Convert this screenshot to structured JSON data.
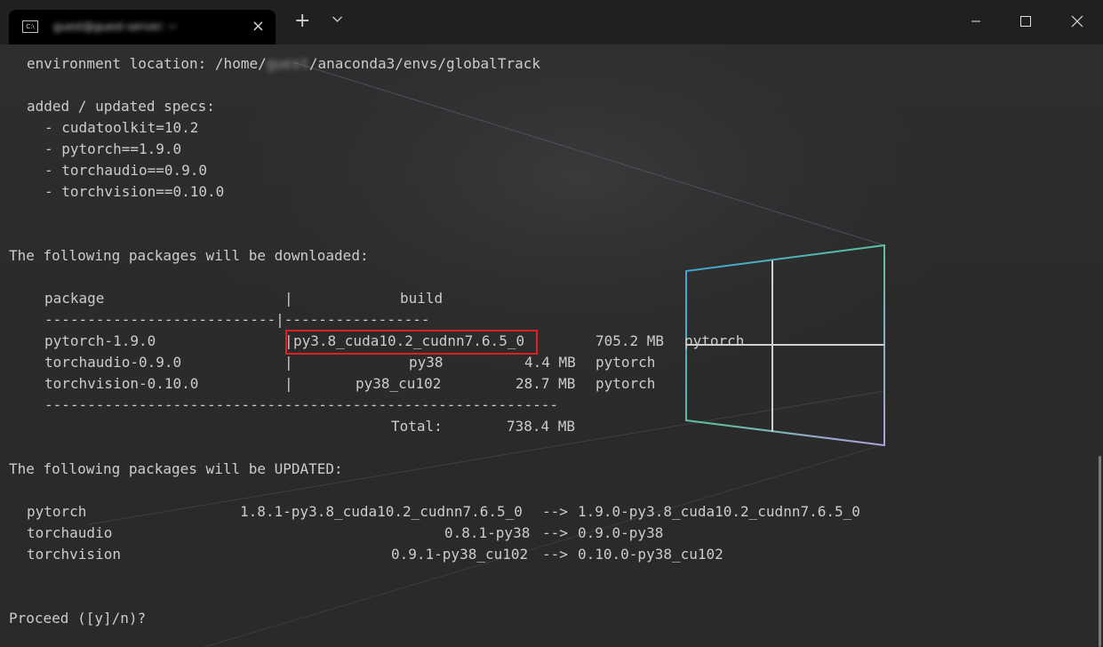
{
  "window": {
    "tab_icon_text": "C:\\",
    "tab_title": "guest@guest-server: ~",
    "tab_close_icon": "×",
    "new_tab_icon": "+"
  },
  "terminal": {
    "env_location_prefix": "environment location: /home/",
    "env_user": "guest",
    "env_location_suffix": "/anaconda3/envs/globalTrack",
    "specs_header": "added / updated specs:",
    "specs": [
      "- cudatoolkit=10.2",
      "- pytorch==1.9.0",
      "- torchaudio==0.9.0",
      "- torchvision==0.10.0"
    ],
    "download_header": "The following packages will be downloaded:",
    "table_header": {
      "package": "package",
      "sep": "|",
      "build": "build"
    },
    "table_rule": "---------------------------|-----------------",
    "downloads": [
      {
        "package": "pytorch-1.9.0",
        "sep": "|",
        "build": "py3.8_cuda10.2_cudnn7.6.5_0",
        "size": "705.2 MB",
        "channel": "pytorch"
      },
      {
        "package": "torchaudio-0.9.0",
        "sep": "|",
        "build": "py38",
        "size": "4.4 MB",
        "channel": "pytorch"
      },
      {
        "package": "torchvision-0.10.0",
        "sep": "|",
        "build": "py38_cu102",
        "size": "28.7 MB",
        "channel": "pytorch"
      }
    ],
    "total_rule": "------------------------------------------------------------",
    "total_label": "Total:",
    "total_value": "738.4 MB",
    "updated_header": "The following packages will be UPDATED:",
    "updates": [
      {
        "name": "pytorch",
        "from": "1.8.1-py3.8_cuda10.2_cudnn7.6.5_0",
        "arrow": "-->",
        "to": "1.9.0-py3.8_cuda10.2_cudnn7.6.5_0"
      },
      {
        "name": "torchaudio",
        "from": "0.8.1-py38",
        "arrow": "-->",
        "to": "0.9.0-py38"
      },
      {
        "name": "torchvision",
        "from": "0.9.1-py38_cu102",
        "arrow": "-->",
        "to": "0.10.0-py38_cu102"
      }
    ],
    "prompt": "Proceed ([y]/n)?"
  },
  "colors": {
    "highlight": "#e02020",
    "terminal_text": "#cccccc"
  }
}
